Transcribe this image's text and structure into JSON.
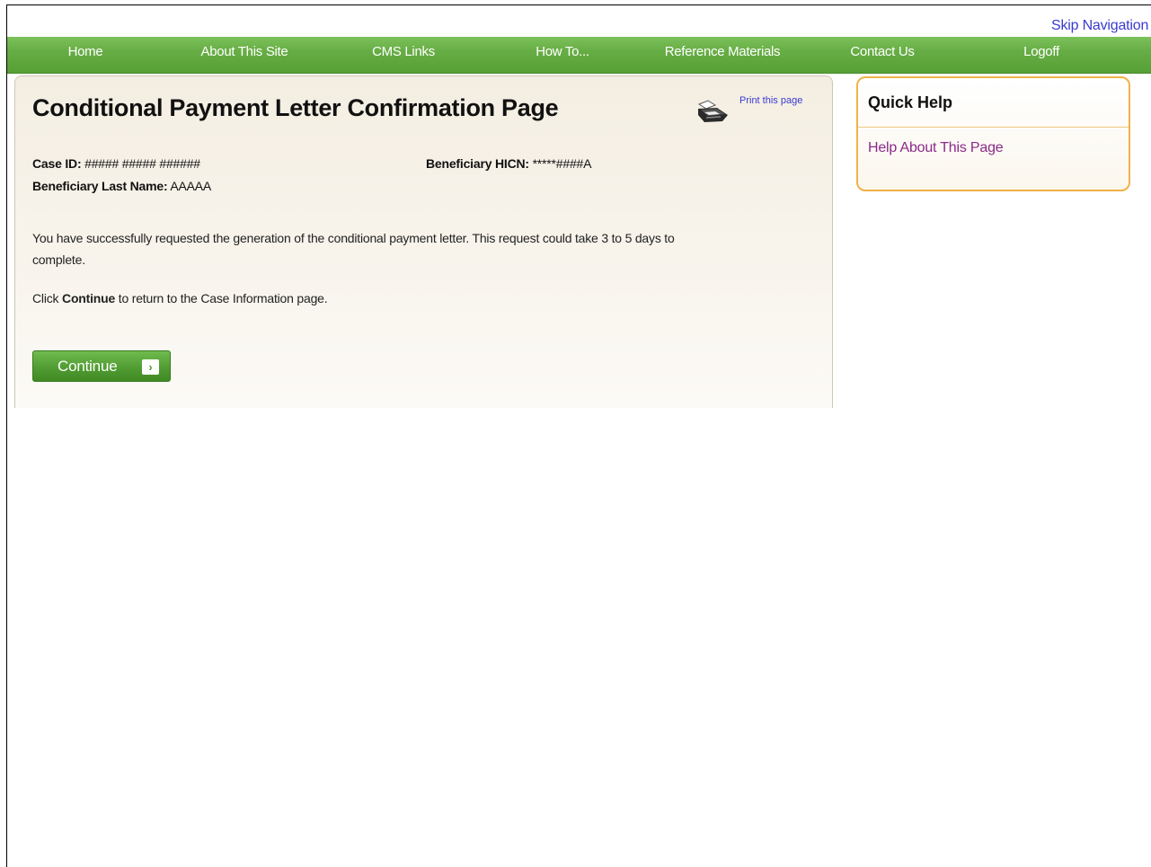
{
  "header": {
    "skip_navigation": "Skip Navigation"
  },
  "nav": {
    "items": [
      {
        "label": "Home"
      },
      {
        "label": "About This Site"
      },
      {
        "label": "CMS Links"
      },
      {
        "label": "How To..."
      },
      {
        "label": "Reference Materials"
      },
      {
        "label": "Contact Us"
      },
      {
        "label": "Logoff"
      }
    ]
  },
  "main": {
    "title": "Conditional Payment Letter Confirmation Page",
    "print_link": "Print this page",
    "print_icon": "printer-icon",
    "case_id_label": "Case ID:",
    "case_id_value": "##### ##### ######",
    "hicn_label": "Beneficiary HICN:",
    "hicn_value": "*****####A",
    "last_name_label": "Beneficiary Last Name:",
    "last_name_value": "AAAAA",
    "message_line1": "You have successfully requested the generation of the conditional payment letter. This request could take 3 to 5 days to",
    "message_line2": "complete.",
    "instruction_prefix": "Click ",
    "instruction_bold": "Continue",
    "instruction_suffix": " to return to the Case Information page.",
    "continue_label": "Continue",
    "continue_icon": "arrow-right-icon"
  },
  "quick_help": {
    "title": "Quick Help",
    "link": "Help About This Page"
  },
  "colors": {
    "nav_green": "#67ad45",
    "panel_bg": "#f4eee2",
    "quick_help_border": "#f0b248",
    "link_blue": "#3a3ad0",
    "link_purple": "#8a2a8a"
  }
}
